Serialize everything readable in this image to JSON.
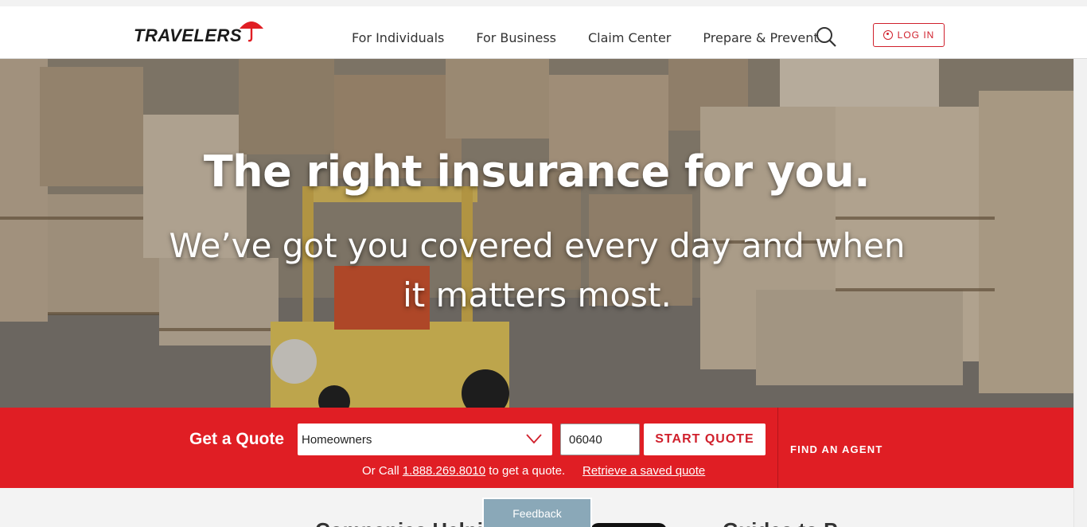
{
  "brand": {
    "name": "TRAVELERS",
    "accent_color": "#e01e24",
    "logo_icon": "umbrella-icon"
  },
  "nav": {
    "items": [
      {
        "label": "For Individuals"
      },
      {
        "label": "For Business"
      },
      {
        "label": "Claim Center"
      },
      {
        "label": "Prepare & Prevent"
      }
    ],
    "search_icon": "search-icon",
    "login_label": "LOG IN",
    "login_icon": "user-circle-icon"
  },
  "hero": {
    "title": "The right insurance for you.",
    "subtitle": "We’ve got you covered every day and when it matters most."
  },
  "quote": {
    "label": "Get a Quote",
    "product_selected": "Homeowners",
    "zip_value": "06040",
    "start_button": "START QUOTE",
    "call_prefix": "Or Call",
    "phone": "1.888.269.8010",
    "call_suffix": "to get a quote.",
    "retrieve_link": "Retrieve a saved quote",
    "find_agent": "FIND AN AGENT"
  },
  "below": {
    "heading_left": "Companies Helpi",
    "heading_right": "Guides to P"
  },
  "feedback": {
    "label": "Feedback"
  }
}
